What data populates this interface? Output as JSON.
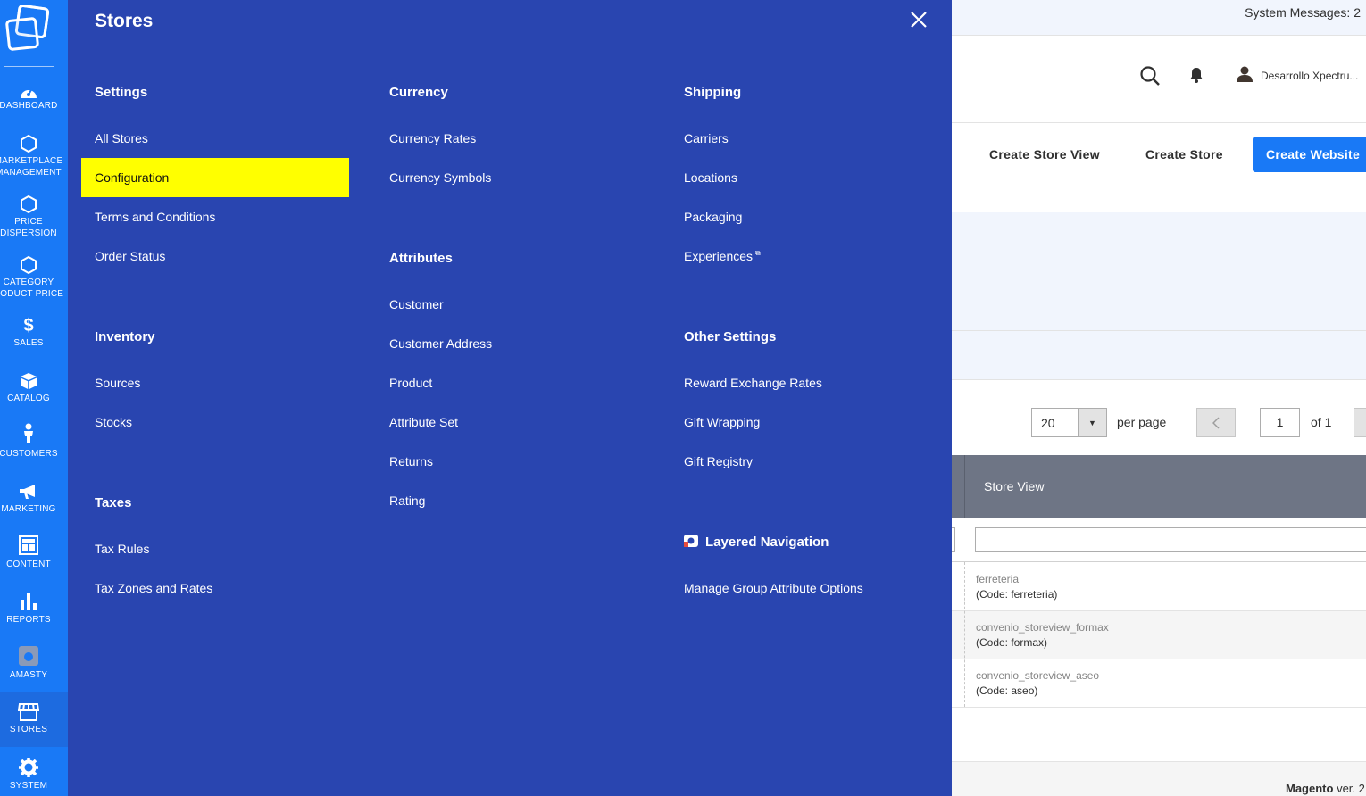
{
  "sidebar": {
    "items": [
      {
        "label": "DASHBOARD",
        "icon": "dashboard-icon"
      },
      {
        "label": "MARKETPLACE\nMANAGEMENT",
        "icon": "hexagon-icon"
      },
      {
        "label": "PRICE\nDISPERSION",
        "icon": "hexagon-icon"
      },
      {
        "label": "CATEGORY\nRODUCT PRICE",
        "icon": "hexagon-icon"
      },
      {
        "label": "SALES",
        "icon": "dollar-icon"
      },
      {
        "label": "CATALOG",
        "icon": "box-icon"
      },
      {
        "label": "CUSTOMERS",
        "icon": "person-icon"
      },
      {
        "label": "MARKETING",
        "icon": "megaphone-icon"
      },
      {
        "label": "CONTENT",
        "icon": "layout-icon"
      },
      {
        "label": "REPORTS",
        "icon": "bar-chart-icon"
      },
      {
        "label": "AMASTY",
        "icon": "amasty-icon"
      },
      {
        "label": "STORES",
        "icon": "store-icon"
      },
      {
        "label": "SYSTEM",
        "icon": "gear-icon"
      }
    ]
  },
  "flyout": {
    "title": "Stores",
    "settings": {
      "title": "Settings",
      "links": [
        "All Stores",
        "Configuration",
        "Terms and Conditions",
        "Order Status"
      ]
    },
    "inventory": {
      "title": "Inventory",
      "links": [
        "Sources",
        "Stocks"
      ]
    },
    "taxes": {
      "title": "Taxes",
      "links": [
        "Tax Rules",
        "Tax Zones and Rates"
      ]
    },
    "currency": {
      "title": "Currency",
      "links": [
        "Currency Rates",
        "Currency Symbols"
      ]
    },
    "attributes": {
      "title": "Attributes",
      "links": [
        "Customer",
        "Customer Address",
        "Product",
        "Attribute Set",
        "Returns",
        "Rating"
      ]
    },
    "shipping": {
      "title": "Shipping",
      "links": [
        "Carriers",
        "Locations",
        "Packaging",
        "Experiences"
      ]
    },
    "other": {
      "title": "Other Settings",
      "links": [
        "Reward Exchange Rates",
        "Gift Wrapping",
        "Gift Registry"
      ]
    },
    "layered": {
      "title": "Layered Navigation",
      "links": [
        "Manage Group Attribute Options"
      ]
    },
    "highlight_color": "#ffff00",
    "bg_color": "#2945b0"
  },
  "page": {
    "system_messages": "System Messages: 2",
    "user_name": "Desarrollo Xpectru...",
    "actions": {
      "create_store_view": "Create Store View",
      "create_store": "Create Store",
      "create_website": "Create Website"
    },
    "pager": {
      "per_page_value": "20",
      "per_page_label": "per page",
      "current_page": "1",
      "of_label": "of 1"
    },
    "grid": {
      "column": "Store View",
      "rows": [
        {
          "name": "ferreteria",
          "code": "(Code: ferreteria)"
        },
        {
          "name": "convenio_storeview_formax",
          "code": "(Code: formax)"
        },
        {
          "name": "convenio_storeview_aseo",
          "code": "(Code: aseo)"
        }
      ]
    },
    "footer": {
      "brand": "Magento",
      "version": "ver. 2"
    }
  },
  "colors": {
    "accent": "#1979f6"
  }
}
